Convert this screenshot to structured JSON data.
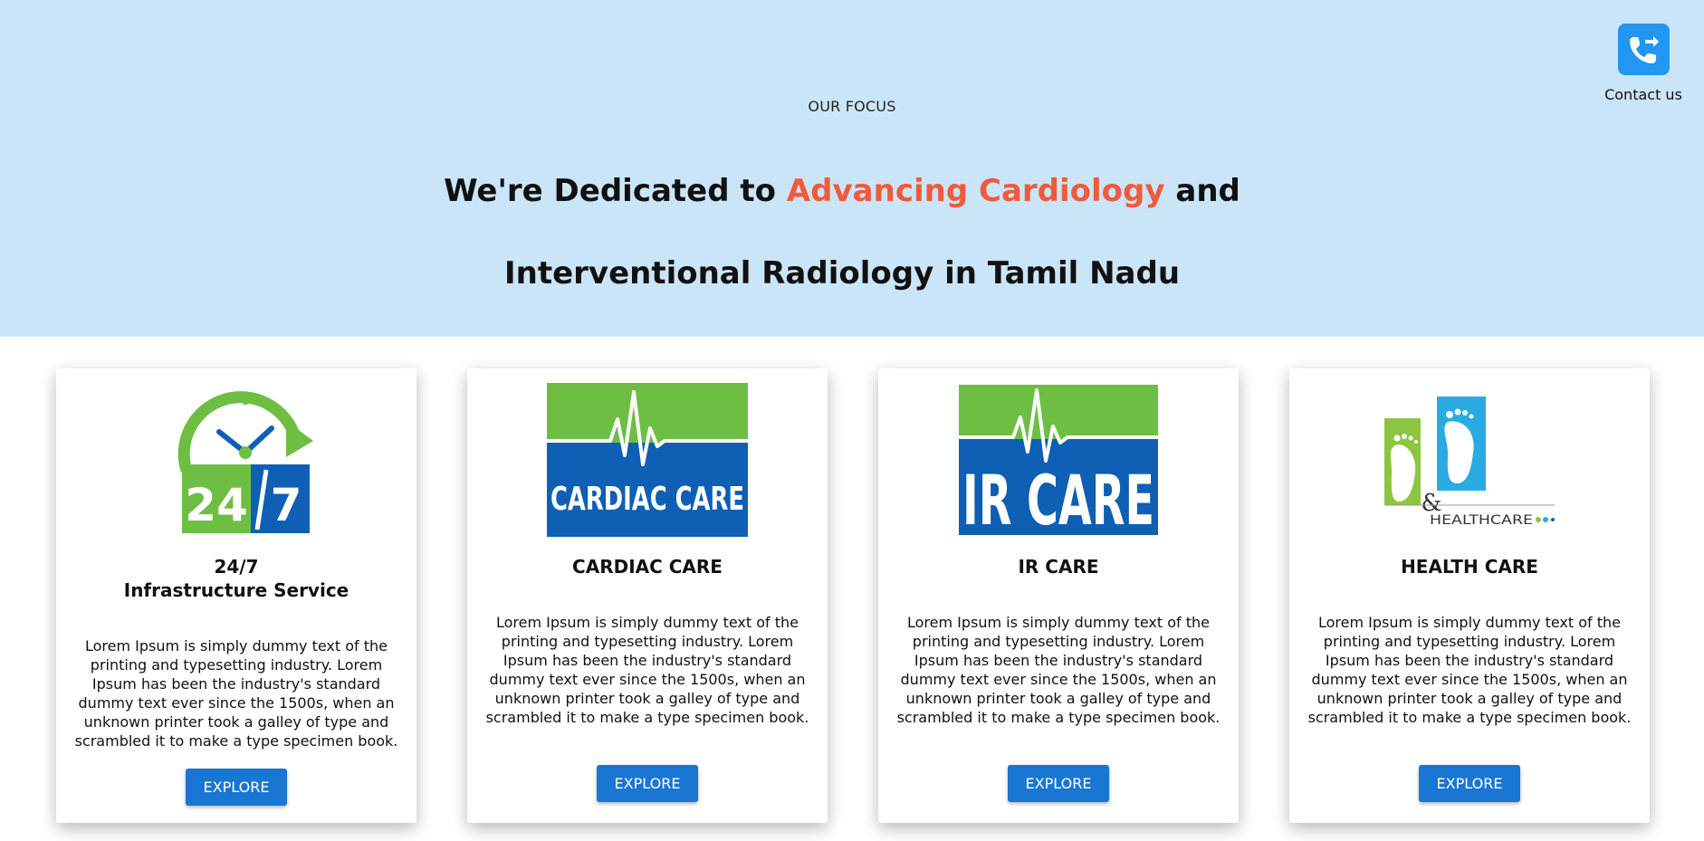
{
  "focus": {
    "eyebrow": "OUR FOCUS",
    "headline_part1": "We're Dedicated to ",
    "headline_accent": "Advancing Cardiology",
    "headline_part2": " and",
    "headline_line2": "Interventional Radiology in Tamil Nadu",
    "accent_color": "#f05a3c",
    "background_color": "#cbe5f8"
  },
  "contact": {
    "label": "Contact us",
    "icon": "phone-forward-icon",
    "color": "#2196f3"
  },
  "cards": [
    {
      "logo": "clock-24-7-icon",
      "title_line1": "24/7",
      "title_line2": "Infrastructure Service",
      "description": "Lorem Ipsum is simply dummy text of the printing and typesetting industry. Lorem Ipsum has been the industry's standard dummy text ever since the 1500s, when an unknown printer took a galley of type and scrambled it to make a type specimen book.",
      "button": "EXPLORE"
    },
    {
      "logo": "cardiac-care-logo",
      "logo_text": "CARDIAC CARE",
      "title_line1": "CARDIAC CARE",
      "description": "Lorem Ipsum is simply dummy text of the printing and typesetting industry. Lorem Ipsum has been the industry's standard dummy text ever since the 1500s, when an unknown printer took a galley of type and scrambled it to make a type specimen book. Lorem Ipsum is simply dummy text of",
      "button": "EXPLORE"
    },
    {
      "logo": "ir-care-logo",
      "logo_text": "IR CARE",
      "title_line1": "IR CARE",
      "description": "Lorem Ipsum is simply dummy text of the printing and typesetting industry. Lorem Ipsum has been the industry's standard dummy text ever since the 1500s, when an unknown printer took a galley of type and scrambled it to make a type specimen book. Lorem Ipsum is simply dummy text of",
      "button": "EXPLORE"
    },
    {
      "logo": "feet-healthcare-logo",
      "logo_text": "HEALTHCARE",
      "logo_amp": "&",
      "title_line1": "HEALTH CARE",
      "description": "Lorem Ipsum is simply dummy text of the printing and typesetting industry. Lorem Ipsum has been the industry's standard dummy text ever since the 1500s, when an unknown printer took a galley of type and scrambled it to make a type specimen book. Lorem Ipsum is simply dummy text of",
      "button": "EXPLORE"
    }
  ],
  "colors": {
    "brand_green": "#6ebe44",
    "brand_blue": "#0f5fb4",
    "button_blue": "#1976d2"
  }
}
